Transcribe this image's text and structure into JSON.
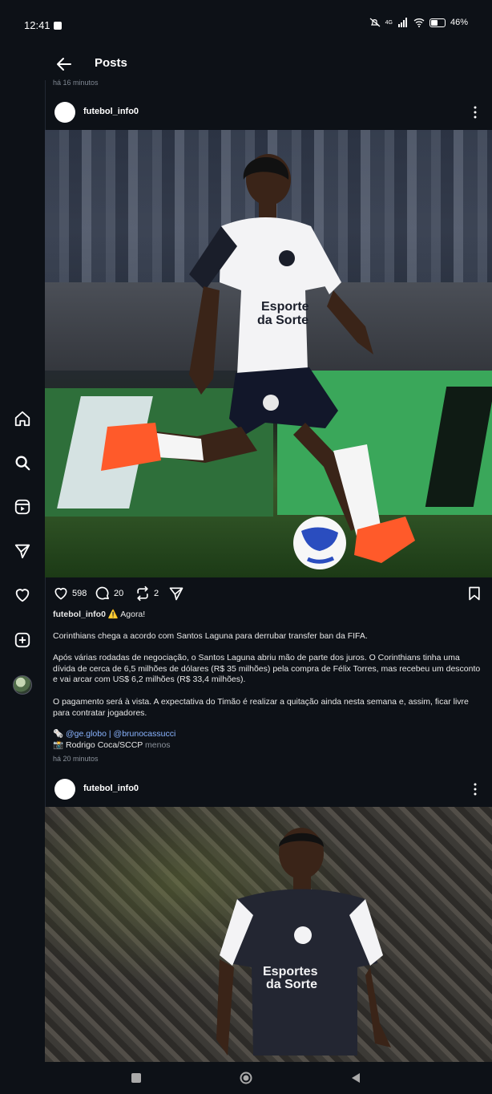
{
  "status_bar": {
    "time": "12:41",
    "network": "4G",
    "battery": "46%"
  },
  "topbar": {
    "title": "Posts"
  },
  "previous_post_time": "há 16 minutos",
  "posts": [
    {
      "username": "futebol_info0",
      "likes": "598",
      "comments": "20",
      "reposts": "2",
      "caption": {
        "user": "futebol_info0",
        "first_line": "⚠️ Agora!",
        "p1": "Corinthians chega a acordo com Santos Laguna para derrubar transfer ban da FIFA.",
        "p2": "Após várias rodadas de negociação, o Santos Laguna abriu mão de parte dos juros. O Corinthians tinha uma dívida de cerca de 6,5 milhões de dólares (R$ 35 milhões) pela compra de Félix Torres, mas recebeu um desconto e vai arcar com US$ 6,2 milhões (R$ 33,4 milhões).",
        "p3": "O pagamento será à vista. A expectativa do Timão é realizar a quitação ainda nesta semana e, assim, ficar livre para contratar jogadores.",
        "source_prefix": "🗞️",
        "source1": "@ge.globo",
        "separator": "|",
        "source2": "@brunocassucci",
        "photo_prefix": "📸",
        "photo_credit": "Rodrigo Coca/SCCP",
        "more": "menos"
      },
      "time_ago": "há 20 minutos"
    },
    {
      "username": "futebol_info0"
    }
  ],
  "icons": {
    "rail": [
      "home-icon",
      "search-icon",
      "reels-icon",
      "send-icon",
      "heart-icon",
      "create-icon",
      "profile-avatar"
    ],
    "actions": [
      "like-icon",
      "comment-icon",
      "repost-icon",
      "share-icon",
      "save-icon"
    ]
  },
  "colors": {
    "background": "#0d1117",
    "link": "#8ab4ff",
    "muted": "#8b929b"
  }
}
